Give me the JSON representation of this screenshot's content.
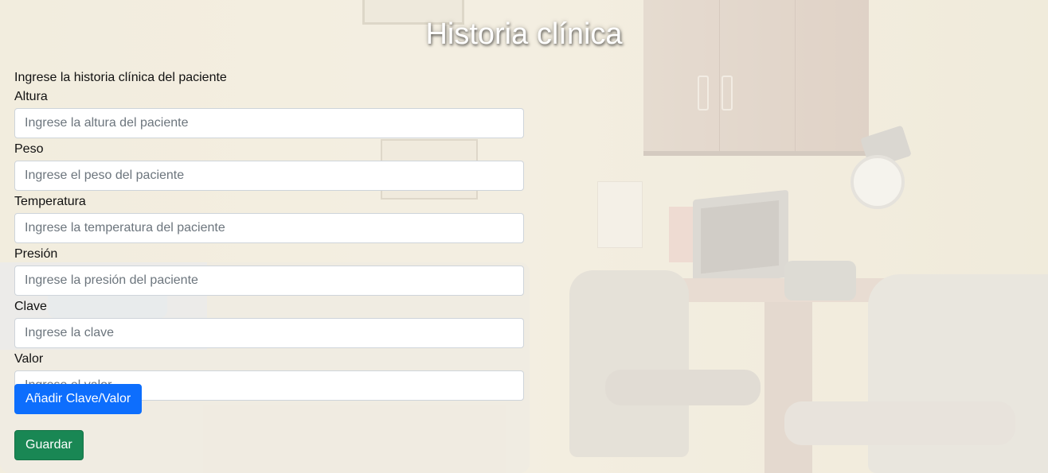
{
  "page": {
    "title": "Historia clínica",
    "intro": "Ingrese la historia clínica del paciente"
  },
  "fields": [
    {
      "label": "Altura",
      "placeholder": "Ingrese la altura del paciente",
      "value": ""
    },
    {
      "label": "Peso",
      "placeholder": "Ingrese el peso del paciente",
      "value": ""
    },
    {
      "label": "Temperatura",
      "placeholder": "Ingrese la temperatura del paciente",
      "value": ""
    },
    {
      "label": "Presión",
      "placeholder": "Ingrese la presión del paciente",
      "value": ""
    },
    {
      "label": "Clave",
      "placeholder": "Ingrese la clave",
      "value": ""
    },
    {
      "label": "Valor",
      "placeholder": "Ingrese el valor",
      "value": ""
    }
  ],
  "buttons": {
    "add_label": "Añadir Clave/Valor",
    "save_label": "Guardar"
  },
  "colors": {
    "primary": "#0d6efd",
    "success": "#198754",
    "title_text": "#ffffff"
  }
}
